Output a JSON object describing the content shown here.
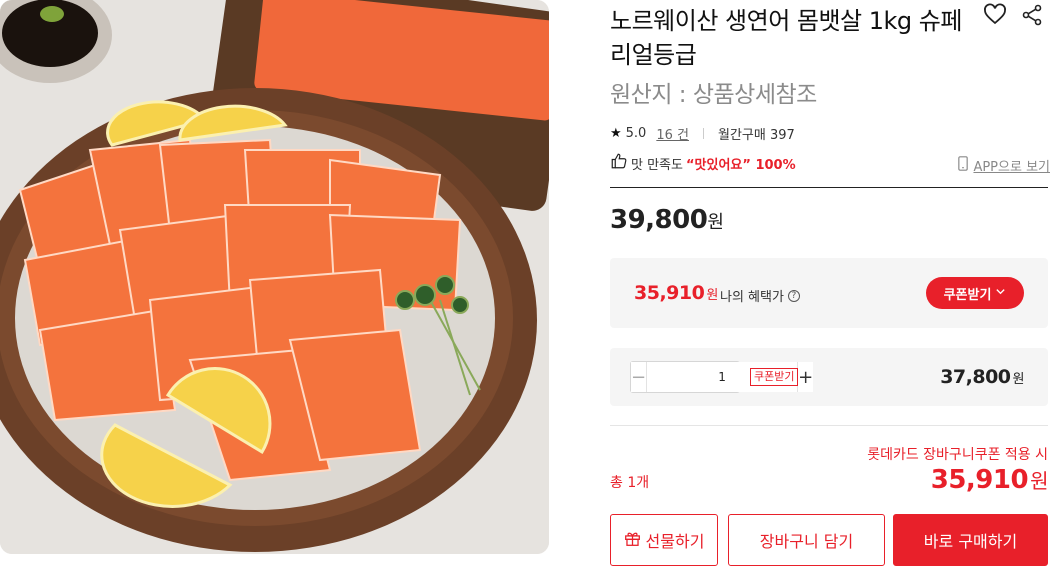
{
  "product": {
    "title": "노르웨이산 생연어 몸뱃살 1kg 슈페리얼등급",
    "origin": "원산지 : 상품상세참조"
  },
  "icons": {
    "wishlist": "heart-outline-icon",
    "share": "share-icon",
    "rating": "star-icon",
    "satisfaction": "thumbs-up-icon",
    "app": "mobile-phone-icon",
    "help": "question-circle-icon",
    "gift": "gift-icon",
    "dropdown": "chevron-down-icon"
  },
  "rating": {
    "score": "5.0",
    "review_count": "16 건",
    "monthly_purchases": "월간구매 397"
  },
  "satisfaction": {
    "label": "맛 만족도",
    "quote": "“맛있어요” 100%"
  },
  "app_link": "APP으로 보기",
  "price": {
    "amount": "39,800",
    "currency": "원"
  },
  "benefit": {
    "amount": "35,910",
    "currency": "원",
    "label": "나의 혜택가",
    "help_glyph": "?",
    "coupon_button": "쿠폰받기"
  },
  "option": {
    "quantity": "1",
    "minus": "−",
    "plus": "+",
    "coupon_tag": "쿠폰받기",
    "amount": "37,800",
    "currency": "원"
  },
  "summary": {
    "card_coupon": "롯데카드 장바구니쿠폰 적용 시",
    "total_label": "총 1개",
    "total_amount": "35,910",
    "currency": "원"
  },
  "actions": {
    "gift": "선물하기",
    "cart": "장바구니 담기",
    "buy": "바로 구매하기"
  },
  "colors": {
    "accent": "#e8202a",
    "text": "#111111",
    "muted": "#8b8b8b",
    "panel": "#f5f5f5"
  }
}
